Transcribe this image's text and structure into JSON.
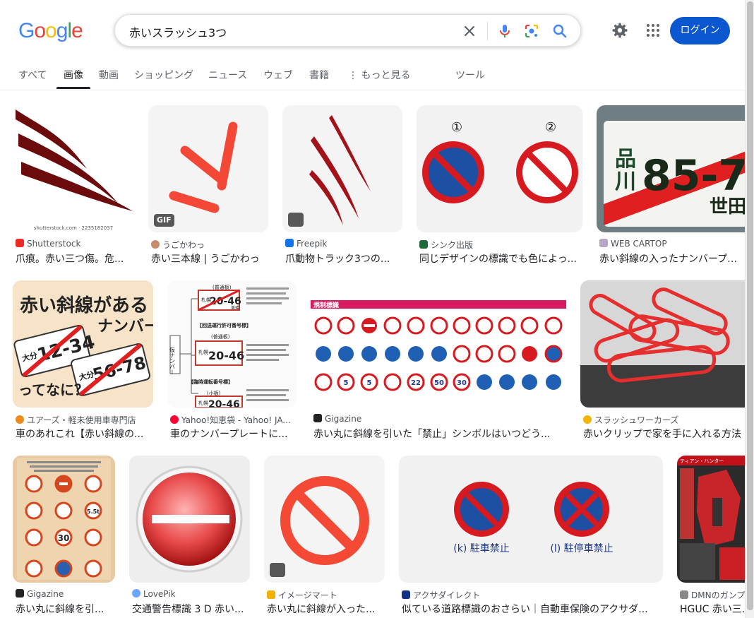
{
  "logo": [
    "G",
    "o",
    "o",
    "g",
    "l",
    "e"
  ],
  "colors": {
    "blue": "#4285f4",
    "red": "#ea4335",
    "yellow": "#fbbc05",
    "green": "#34a853",
    "login_bg": "#0b57d0"
  },
  "search": {
    "query": "赤いスラッシュ3つ"
  },
  "login_label": "ログイン",
  "tabs": [
    {
      "label": "すべて"
    },
    {
      "label": "画像"
    },
    {
      "label": "動画"
    },
    {
      "label": "ショッピング"
    },
    {
      "label": "ニュース"
    },
    {
      "label": "ウェブ"
    },
    {
      "label": "書籍"
    },
    {
      "label": "もっと見る"
    },
    {
      "label": "ツール"
    }
  ],
  "results": [
    {
      "source": "Shutterstock",
      "title": "爪痕。赤い三つ傷。危...",
      "watermark": "shutterstock.com · 2235182037"
    },
    {
      "source": "うごかわっ",
      "title": "赤い三本線 | うごかわっ",
      "badge": "GIF"
    },
    {
      "source": "Freepik",
      "title": "爪動物トラック3つの..."
    },
    {
      "source": "シンク出版",
      "title": "同じデザインの標識でも色によっ...",
      "labels": [
        "①",
        "②"
      ]
    },
    {
      "source": "WEB CARTOP",
      "title": "赤い斜線の入ったナンバープレー...",
      "plate": [
        "品",
        "川",
        "85-7",
        "世田"
      ]
    },
    {
      "source": "ユアーズ・軽未使用車専門店",
      "title": "車のあれこれ【赤い斜線の...",
      "text": [
        "赤い斜線がある",
        "ナンバー",
        "大分",
        "12-34",
        "大分",
        "56-78",
        "ってなに？"
      ]
    },
    {
      "source": "Yahoo!知恵袋 - Yahoo! JA...",
      "title": "車のナンバープレートに...",
      "text": [
        "(普通板)",
        "札幌",
        "20-46",
        "美瑛",
        "仮ナンバー",
        "【回送運行許可番号標】",
        "(普通板)",
        "札幌",
        "20-46",
        "【臨時運転番号標】",
        "(小板)",
        "札幌",
        "20-46"
      ]
    },
    {
      "source": "Gigazine",
      "title": "赤い丸に斜線を引いた「禁止」シンボルはいつどう...",
      "header": "規制標識",
      "speeds": [
        "5",
        "5",
        "30",
        "22",
        "50",
        "30"
      ]
    },
    {
      "source": "スラッシュワーカーズ",
      "title": "赤いクリップで家を手に入れる方法"
    },
    {
      "source": "Gigazine",
      "title": "赤い丸に斜線を引...",
      "speed": [
        "5.5t",
        "30"
      ]
    },
    {
      "source": "LovePik",
      "title": "交通警告標識 3 D 赤い..."
    },
    {
      "source": "イメージマート",
      "title": "赤い丸に斜線が入った..."
    },
    {
      "source": "アクサダイレクト",
      "title": "似ている道路標識のおさらい｜自動車保険のアクサダ...",
      "captions": [
        "(k) 駐車禁止",
        "(l) 駐停車禁止"
      ]
    },
    {
      "source": "DMNのガンプ...",
      "title": "HGUC 赤い三...",
      "text": [
        "ティアン・ハンター"
      ]
    }
  ]
}
